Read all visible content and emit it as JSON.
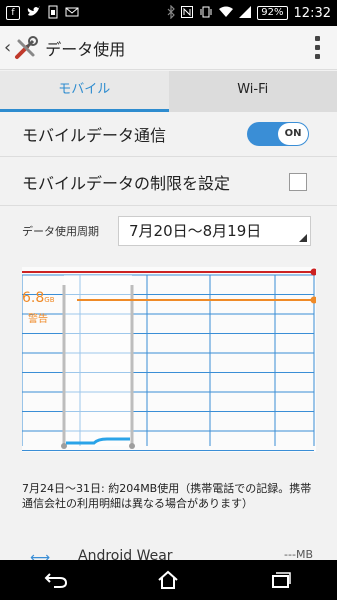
{
  "status_bar": {
    "time": "12:32",
    "battery": "92%",
    "icons": [
      "facebook-icon",
      "twitter-icon",
      "sim-icon",
      "mail-icon",
      "bluetooth-icon",
      "nfc-icon",
      "vibrate-icon",
      "wifi-icon",
      "signal-icon",
      "battery-icon"
    ]
  },
  "action_bar": {
    "back_glyph": "‹",
    "title": "データ使用"
  },
  "tabs": [
    {
      "label": "モバイル",
      "selected": true
    },
    {
      "label": "Wi-Fi",
      "selected": false
    }
  ],
  "settings": {
    "mobile_data": {
      "label": "モバイルデータ通信",
      "toggle_label": "ON",
      "enabled": true
    },
    "limit": {
      "label": "モバイルデータの制限を設定",
      "checked": false
    }
  },
  "cycle": {
    "label": "データ使用周期",
    "value": "7月20日～8月19日"
  },
  "chart": {
    "warning_value": "6.8",
    "warning_unit": "GB",
    "warning_label": "警告"
  },
  "usage_summary": "7月24日～31日: 約204MB使用（携帯電話での記録。携帯通信会社の利用明細は異なる場合があります）",
  "app_list": {
    "first_item_name": "Android Wear",
    "first_item_size": "---MB"
  },
  "nav": [
    "back-icon",
    "home-icon",
    "recent-apps-icon"
  ],
  "colors": {
    "accent": "#2e8ccf",
    "limit_line": "#cc2222",
    "warning_line": "#ef8a27",
    "grid": "#3a8ed6"
  }
}
